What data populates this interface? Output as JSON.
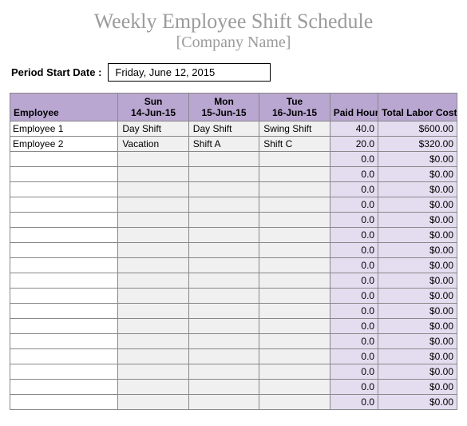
{
  "header": {
    "title": "Weekly Employee Shift Schedule",
    "subtitle": "[Company Name]"
  },
  "period": {
    "label": "Period Start Date :",
    "value": "Friday, June 12, 2015"
  },
  "columns": {
    "employee": "Employee",
    "days": [
      {
        "dow": "Sun",
        "date": "14-Jun-15"
      },
      {
        "dow": "Mon",
        "date": "15-Jun-15"
      },
      {
        "dow": "Tue",
        "date": "16-Jun-15"
      }
    ],
    "paid_hours": "Paid Hours",
    "labor_cost": "Total Labor Cost"
  },
  "rows": [
    {
      "employee": "Employee 1",
      "shifts": [
        {
          "label": "Day Shift",
          "cls": "dayshift"
        },
        {
          "label": "Day Shift",
          "cls": "dayshift"
        },
        {
          "label": "Swing Shift",
          "cls": "swingshift"
        }
      ],
      "hours": "40.0",
      "cost": "$600.00"
    },
    {
      "employee": "Employee 2",
      "shifts": [
        {
          "label": "Vacation",
          "cls": "vacation"
        },
        {
          "label": "Shift A",
          "cls": "shifta"
        },
        {
          "label": "Shift C",
          "cls": "shiftc"
        }
      ],
      "hours": "20.0",
      "cost": "$320.00"
    },
    {
      "employee": "",
      "shifts": [
        {
          "label": "",
          "cls": ""
        },
        {
          "label": "",
          "cls": ""
        },
        {
          "label": "",
          "cls": ""
        }
      ],
      "hours": "0.0",
      "cost": "$0.00"
    },
    {
      "employee": "",
      "shifts": [
        {
          "label": "",
          "cls": ""
        },
        {
          "label": "",
          "cls": ""
        },
        {
          "label": "",
          "cls": ""
        }
      ],
      "hours": "0.0",
      "cost": "$0.00"
    },
    {
      "employee": "",
      "shifts": [
        {
          "label": "",
          "cls": ""
        },
        {
          "label": "",
          "cls": ""
        },
        {
          "label": "",
          "cls": ""
        }
      ],
      "hours": "0.0",
      "cost": "$0.00"
    },
    {
      "employee": "",
      "shifts": [
        {
          "label": "",
          "cls": ""
        },
        {
          "label": "",
          "cls": ""
        },
        {
          "label": "",
          "cls": ""
        }
      ],
      "hours": "0.0",
      "cost": "$0.00"
    },
    {
      "employee": "",
      "shifts": [
        {
          "label": "",
          "cls": ""
        },
        {
          "label": "",
          "cls": ""
        },
        {
          "label": "",
          "cls": ""
        }
      ],
      "hours": "0.0",
      "cost": "$0.00"
    },
    {
      "employee": "",
      "shifts": [
        {
          "label": "",
          "cls": ""
        },
        {
          "label": "",
          "cls": ""
        },
        {
          "label": "",
          "cls": ""
        }
      ],
      "hours": "0.0",
      "cost": "$0.00"
    },
    {
      "employee": "",
      "shifts": [
        {
          "label": "",
          "cls": ""
        },
        {
          "label": "",
          "cls": ""
        },
        {
          "label": "",
          "cls": ""
        }
      ],
      "hours": "0.0",
      "cost": "$0.00"
    },
    {
      "employee": "",
      "shifts": [
        {
          "label": "",
          "cls": ""
        },
        {
          "label": "",
          "cls": ""
        },
        {
          "label": "",
          "cls": ""
        }
      ],
      "hours": "0.0",
      "cost": "$0.00"
    },
    {
      "employee": "",
      "shifts": [
        {
          "label": "",
          "cls": ""
        },
        {
          "label": "",
          "cls": ""
        },
        {
          "label": "",
          "cls": ""
        }
      ],
      "hours": "0.0",
      "cost": "$0.00"
    },
    {
      "employee": "",
      "shifts": [
        {
          "label": "",
          "cls": ""
        },
        {
          "label": "",
          "cls": ""
        },
        {
          "label": "",
          "cls": ""
        }
      ],
      "hours": "0.0",
      "cost": "$0.00"
    },
    {
      "employee": "",
      "shifts": [
        {
          "label": "",
          "cls": ""
        },
        {
          "label": "",
          "cls": ""
        },
        {
          "label": "",
          "cls": ""
        }
      ],
      "hours": "0.0",
      "cost": "$0.00"
    },
    {
      "employee": "",
      "shifts": [
        {
          "label": "",
          "cls": ""
        },
        {
          "label": "",
          "cls": ""
        },
        {
          "label": "",
          "cls": ""
        }
      ],
      "hours": "0.0",
      "cost": "$0.00"
    },
    {
      "employee": "",
      "shifts": [
        {
          "label": "",
          "cls": ""
        },
        {
          "label": "",
          "cls": ""
        },
        {
          "label": "",
          "cls": ""
        }
      ],
      "hours": "0.0",
      "cost": "$0.00"
    },
    {
      "employee": "",
      "shifts": [
        {
          "label": "",
          "cls": ""
        },
        {
          "label": "",
          "cls": ""
        },
        {
          "label": "",
          "cls": ""
        }
      ],
      "hours": "0.0",
      "cost": "$0.00"
    },
    {
      "employee": "",
      "shifts": [
        {
          "label": "",
          "cls": ""
        },
        {
          "label": "",
          "cls": ""
        },
        {
          "label": "",
          "cls": ""
        }
      ],
      "hours": "0.0",
      "cost": "$0.00"
    },
    {
      "employee": "",
      "shifts": [
        {
          "label": "",
          "cls": ""
        },
        {
          "label": "",
          "cls": ""
        },
        {
          "label": "",
          "cls": ""
        }
      ],
      "hours": "0.0",
      "cost": "$0.00"
    },
    {
      "employee": "",
      "shifts": [
        {
          "label": "",
          "cls": ""
        },
        {
          "label": "",
          "cls": ""
        },
        {
          "label": "",
          "cls": ""
        }
      ],
      "hours": "0.0",
      "cost": "$0.00"
    }
  ]
}
